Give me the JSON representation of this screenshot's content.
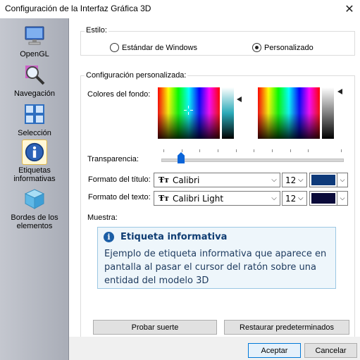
{
  "window": {
    "title": "Configuración de la Interfaz Gráfica 3D",
    "close_glyph": "✕"
  },
  "sidebar": {
    "items": [
      {
        "label": "OpenGL",
        "icon": "monitor-icon"
      },
      {
        "label": "Navegación",
        "icon": "magnifier-icon"
      },
      {
        "label": "Selección",
        "icon": "grid-icon"
      },
      {
        "label_line1": "Etiquetas",
        "label_line2": "informativas",
        "icon": "info-icon",
        "selected": true
      },
      {
        "label_line1": "Bordes de los",
        "label_line2": "elementos",
        "icon": "cube-icon"
      }
    ]
  },
  "style_group": {
    "label": "Estilo:",
    "options": [
      {
        "label": "Estándar de Windows",
        "selected": false
      },
      {
        "label": "Personalizado",
        "selected": true
      }
    ]
  },
  "custom_group": {
    "label": "Configuración personalizada:",
    "background_colors_label": "Colores del fondo:",
    "transparency_label": "Transparencia:",
    "transparency_value": 0.1,
    "title_format_label": "Formato del título:",
    "title_font": "Calibri",
    "title_size": "12",
    "title_color": "#0e3a7a",
    "text_format_label": "Formato del texto:",
    "text_font": "Calibri Light",
    "text_size": "12",
    "text_color": "#0b0b3a",
    "font_type_glyph": "Ŧт",
    "sample_label": "Muestra:",
    "preview": {
      "title": "Etiqueta informativa",
      "info_glyph": "i",
      "body": "Ejemplo de etiqueta informativa que aparece en pantalla al pasar el cursor del ratón sobre una entidad del modelo 3D"
    },
    "buttons": {
      "probar": "Probar suerte",
      "restaurar": "Restaurar predeterminados"
    }
  },
  "footer": {
    "accept": "Aceptar",
    "cancel": "Cancelar"
  },
  "chevron_glyph": "⌵"
}
